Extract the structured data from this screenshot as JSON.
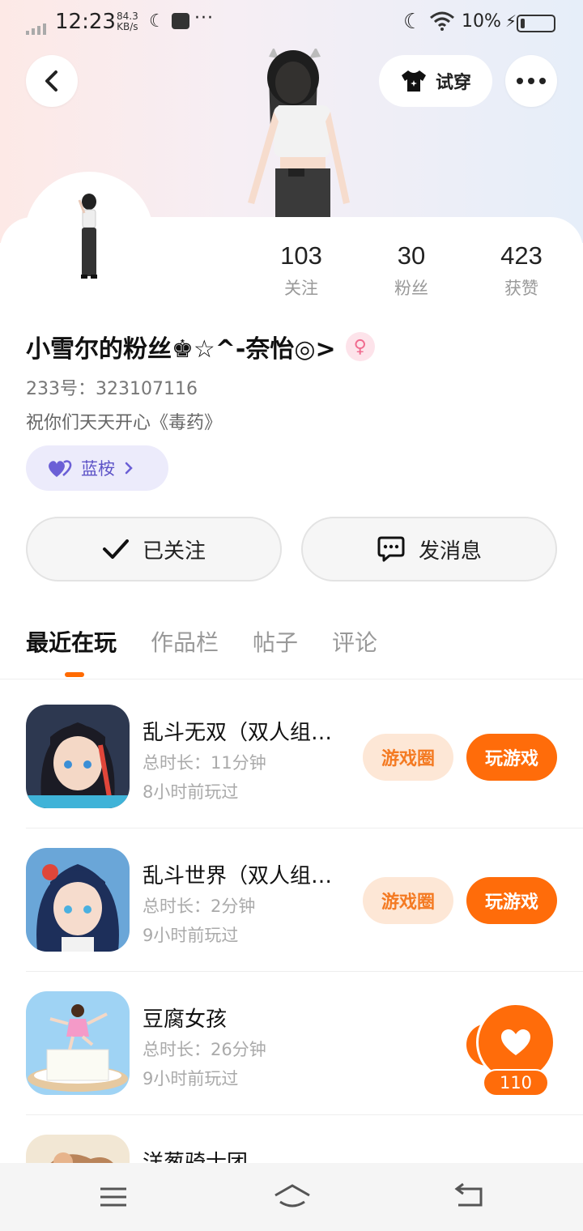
{
  "status_bar": {
    "time": "12:23",
    "speed_value": "84.3",
    "speed_unit": "KB/s",
    "battery": "10%"
  },
  "header": {
    "tryon_label": "试穿"
  },
  "profile": {
    "name": "小雪尔的粉丝♚☆^-奈怡◎>",
    "gender_symbol": "♀",
    "id_label": "233号：323107116",
    "signature": "祝你们天天开心《毒药》",
    "tag_label": "蓝桉",
    "stats": [
      {
        "value": "103",
        "label": "关注"
      },
      {
        "value": "30",
        "label": "粉丝"
      },
      {
        "value": "423",
        "label": "获赞"
      }
    ]
  },
  "actions": {
    "follow_label": "已关注",
    "message_label": "发消息"
  },
  "tabs": [
    {
      "label": "最近在玩",
      "active": true
    },
    {
      "label": "作品栏",
      "active": false
    },
    {
      "label": "帖子",
      "active": false
    },
    {
      "label": "评论",
      "active": false
    }
  ],
  "games": [
    {
      "title": "乱斗无双（双人组…",
      "duration": "总时长：11分钟",
      "last_played": "8小时前玩过",
      "circle_label": "游戏圈",
      "play_label": "玩游戏"
    },
    {
      "title": "乱斗世界（双人组…",
      "duration": "总时长：2分钟",
      "last_played": "9小时前玩过",
      "circle_label": "游戏圈",
      "play_label": "玩游戏"
    },
    {
      "title": "豆腐女孩",
      "duration": "总时长：26分钟",
      "last_played": "9小时前玩过"
    },
    {
      "title": "洋葱骑士团"
    }
  ],
  "like_widget": {
    "count": "110"
  },
  "colors": {
    "accent": "#ff6c0a",
    "tag_bg": "#ecebfb",
    "tag_text": "#5d53c7"
  }
}
